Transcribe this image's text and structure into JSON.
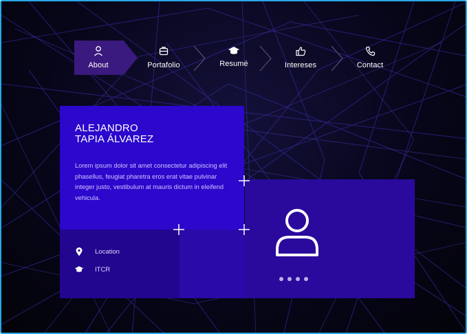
{
  "nav": {
    "items": [
      {
        "label": "About",
        "icon": "user-icon",
        "active": true
      },
      {
        "label": "Portafolio",
        "icon": "briefcase-icon",
        "active": false
      },
      {
        "label": "Resumé",
        "icon": "graduation-cap-icon",
        "active": false
      },
      {
        "label": "Intereses",
        "icon": "thumbs-up-icon",
        "active": false
      },
      {
        "label": "Contact",
        "icon": "phone-icon",
        "active": false
      }
    ]
  },
  "profile": {
    "name_line1": "ALEJANDRO",
    "name_line2": "TAPIA ÁLVAREZ",
    "bio": "Lorem ipsum dolor sit amet consectetur adipiscing elit phasellus, feugiat pharetra eros erat vitae pulvinar integer justo, vestibulum at mauris dictum in eleifend vehicula.",
    "location_label": "Location",
    "location_icon": "map-pin-icon",
    "school_label": "ITCR",
    "school_icon": "graduation-cap-icon"
  },
  "avatar": {
    "icon": "user-outline-icon"
  },
  "carousel": {
    "dot_count": 4
  },
  "colors": {
    "accent": "#2c07cc",
    "card_dark": "#22068f",
    "card_right": "#2a0a9c",
    "nav_active": "#3a1a7e",
    "border": "#2aa7e6"
  }
}
